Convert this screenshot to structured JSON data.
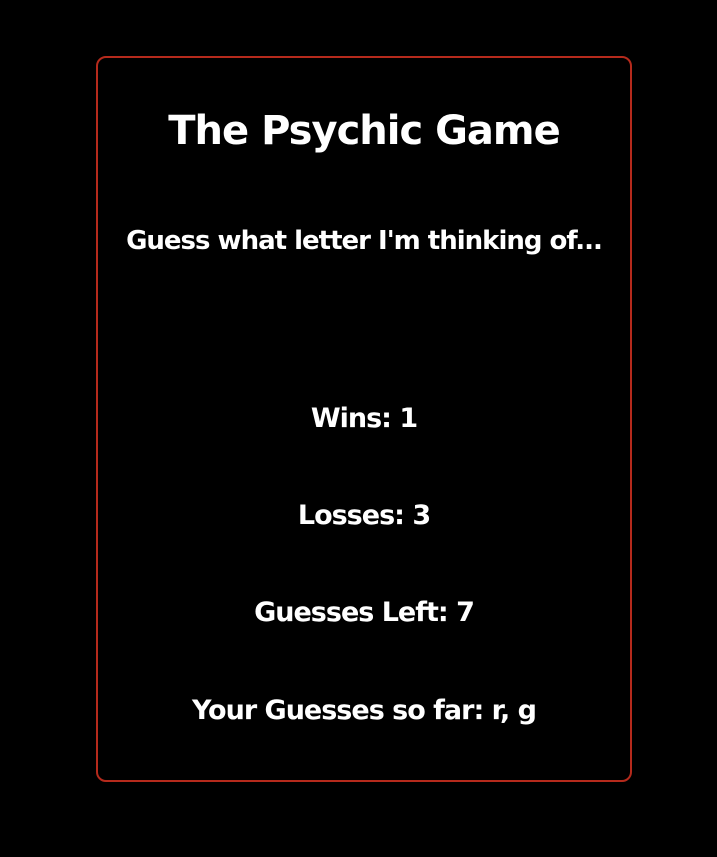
{
  "game": {
    "title": "The Psychic Game",
    "subtitle": "Guess what letter I'm thinking of...",
    "wins_text": "Wins: 1",
    "losses_text": "Losses: 3",
    "guesses_left_text": "Guesses Left: 7",
    "guesses_so_far_text": "Your Guesses so far: r, g"
  },
  "colors": {
    "background": "#000000",
    "card_border": "#b52a1c",
    "text": "#ffffff"
  }
}
